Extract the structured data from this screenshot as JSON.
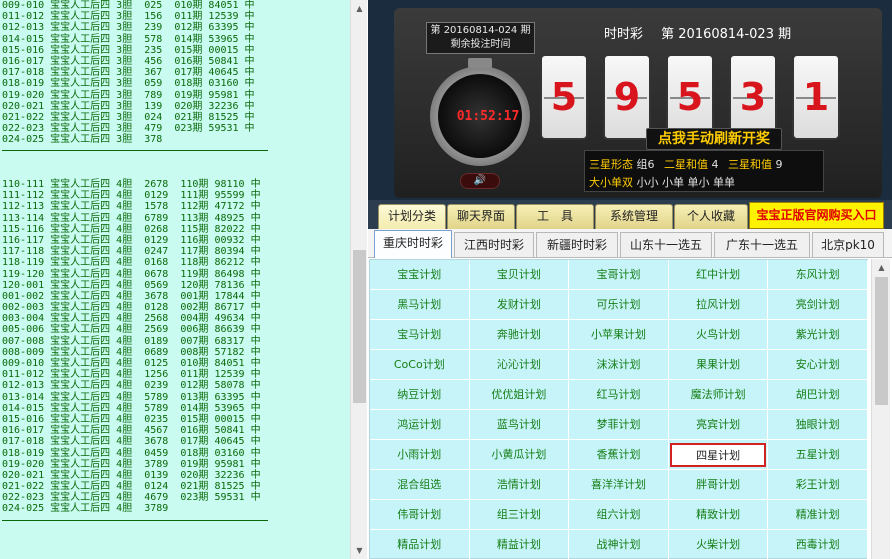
{
  "log_lines": [
    "009-010 宝宝人工后四 3胆  025  010期 84051 中",
    "011-012 宝宝人工后四 3胆  156  011期 12539 中",
    "012-013 宝宝人工后四 3胆  239  012期 63395 中",
    "014-015 宝宝人工后四 3胆  578  014期 53965 中",
    "015-016 宝宝人工后四 3胆  235  015期 00015 中",
    "016-017 宝宝人工后四 3胆  456  016期 50841 中",
    "017-018 宝宝人工后四 3胆  367  017期 40645 中",
    "018-019 宝宝人工后四 3胆  059  018期 03160 中",
    "019-020 宝宝人工后四 3胆  789  019期 95981 中",
    "020-021 宝宝人工后四 3胆  139  020期 32236 中",
    "021-022 宝宝人工后四 3胆  024  021期 81525 中",
    "022-023 宝宝人工后四 3胆  479  023期 59531 中",
    "024-025 宝宝人工后四 3胆  378",
    "---",
    "",
    "",
    "110-111 宝宝人工后四 4胆  2678  110期 98110 中",
    "111-112 宝宝人工后四 4胆  0129  111期 95599 中",
    "112-113 宝宝人工后四 4胆  1578  112期 47172 中",
    "113-114 宝宝人工后四 4胆  6789  113期 48925 中",
    "115-116 宝宝人工后四 4胆  0268  115期 82022 中",
    "116-117 宝宝人工后四 4胆  0129  116期 00932 中",
    "117-118 宝宝人工后四 4胆  0247  117期 80394 中",
    "118-119 宝宝人工后四 4胆  0168  118期 86212 中",
    "119-120 宝宝人工后四 4胆  0678  119期 86498 中",
    "120-001 宝宝人工后四 4胆  0569  120期 78136 中",
    "001-002 宝宝人工后四 4胆  3678  001期 17844 中",
    "002-003 宝宝人工后四 4胆  0128  002期 86717 中",
    "003-004 宝宝人工后四 4胆  2568  004期 49634 中",
    "005-006 宝宝人工后四 4胆  2569  006期 86639 中",
    "007-008 宝宝人工后四 4胆  0189  007期 68317 中",
    "008-009 宝宝人工后四 4胆  0689  008期 57182 中",
    "009-010 宝宝人工后四 4胆  0125  010期 84051 中",
    "011-012 宝宝人工后四 4胆  1256  011期 12539 中",
    "012-013 宝宝人工后四 4胆  0239  012期 58078 中",
    "013-014 宝宝人工后四 4胆  5789  013期 63395 中",
    "014-015 宝宝人工后四 4胆  5789  014期 53965 中",
    "015-016 宝宝人工后四 4胆  0235  015期 00015 中",
    "016-017 宝宝人工后四 4胆  4567  016期 50841 中",
    "017-018 宝宝人工后四 4胆  3678  017期 40645 中",
    "018-019 宝宝人工后四 4胆  0459  018期 03160 中",
    "019-020 宝宝人工后四 4胆  3789  019期 95981 中",
    "020-021 宝宝人工后四 4胆  0139  020期 32236 中",
    "021-022 宝宝人工后四 4胆  0124  021期 81525 中",
    "022-023 宝宝人工后四 4胆  4679  023期 59531 中",
    "024-025 宝宝人工后四 4胆  3789",
    "---"
  ],
  "lottery": {
    "next_draw_line1": "第 20160814-024 期",
    "next_draw_line2": "剩余投注时间",
    "countdown": "01:52:17",
    "title_game": "时时彩",
    "title_period": "第 20160814-023 期",
    "numbers": [
      "5",
      "9",
      "5",
      "3",
      "1"
    ],
    "refresh_label": "点我手动刷新开奖",
    "sound_icon": "speaker-icon",
    "form": {
      "sanxing_label": "三星形态",
      "sanxing_value": "组6",
      "erxing_label": "二星和值",
      "erxing_value": "4",
      "sanxing_sum_label": "三星和值",
      "sanxing_sum_value": "9",
      "daxiao_label": "大小单双",
      "daxiao_values": "小小  小单  单小  单单"
    }
  },
  "menu_tabs": [
    "计划分类",
    "聊天界面",
    "工　具",
    "系统管理",
    "个人收藏"
  ],
  "buy_label": "宝宝正版官网购买入口",
  "lottery_types": [
    "重庆时时彩",
    "江西时时彩",
    "新疆时时彩",
    "山东十一选五",
    "广东十一选五",
    "北京pk10"
  ],
  "plans": [
    "宝宝计划",
    "宝贝计划",
    "宝哥计划",
    "红中计划",
    "东风计划",
    "黑马计划",
    "发财计划",
    "可乐计划",
    "拉风计划",
    "亮剑计划",
    "宝马计划",
    "奔驰计划",
    "小苹果计划",
    "火鸟计划",
    "紫光计划",
    "CoCo计划",
    "沁沁计划",
    "沫沫计划",
    "果果计划",
    "安心计划",
    "纳豆计划",
    "优优姐计划",
    "红马计划",
    "魔法师计划",
    "胡巴计划",
    "鸿运计划",
    "蓝鸟计划",
    "梦菲计划",
    "亮宾计划",
    "独眼计划",
    "小雨计划",
    "小黄瓜计划",
    "香蕉计划",
    "四星计划",
    "五星计划",
    "混合组选",
    "浩情计划",
    "喜洋洋计划",
    "胖哥计划",
    "彩王计划",
    "伟哥计划",
    "组三计划",
    "组六计划",
    "精致计划",
    "精准计划",
    "精品计划",
    "精益计划",
    "战神计划",
    "火柴计划",
    "西毒计划"
  ],
  "selected_plan": "四星计划",
  "colors": {
    "log_bg": "#c9fbf0",
    "log_text": "#0a6a0a",
    "grid_bg": "#c6f4f9",
    "grid_text": "#157e15",
    "tile_digit": "#d8141c",
    "accent_yellow": "#ffcc00"
  }
}
